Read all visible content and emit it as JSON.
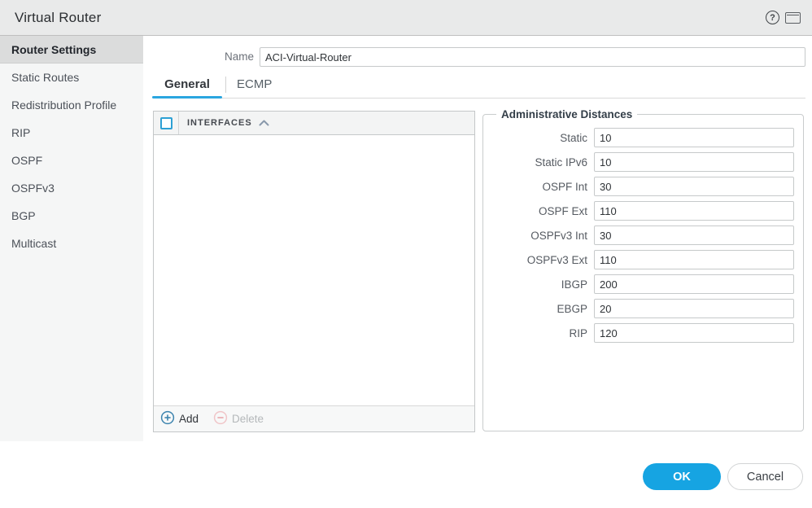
{
  "dialog": {
    "title": "Virtual Router"
  },
  "titlebar": {
    "help_icon": "?",
    "icons": [
      "help-icon",
      "window-icon"
    ]
  },
  "sidebar": {
    "items": [
      {
        "label": "Router Settings",
        "selected": true
      },
      {
        "label": "Static Routes",
        "selected": false
      },
      {
        "label": "Redistribution Profile",
        "selected": false
      },
      {
        "label": "RIP",
        "selected": false
      },
      {
        "label": "OSPF",
        "selected": false
      },
      {
        "label": "OSPFv3",
        "selected": false
      },
      {
        "label": "BGP",
        "selected": false
      },
      {
        "label": "Multicast",
        "selected": false
      }
    ]
  },
  "form": {
    "name_label": "Name",
    "name_value": "ACI-Virtual-Router"
  },
  "tabs": [
    {
      "label": "General",
      "active": true
    },
    {
      "label": "ECMP",
      "active": false
    }
  ],
  "interfaces_table": {
    "column_header": "INTERFACES",
    "sort_direction": "ascending",
    "rows": [],
    "add_label": "Add",
    "delete_label": "Delete",
    "delete_enabled": false
  },
  "admin_distances": {
    "legend": "Administrative Distances",
    "fields": [
      {
        "label": "Static",
        "value": "10"
      },
      {
        "label": "Static IPv6",
        "value": "10"
      },
      {
        "label": "OSPF Int",
        "value": "30"
      },
      {
        "label": "OSPF Ext",
        "value": "110"
      },
      {
        "label": "OSPFv3 Int",
        "value": "30"
      },
      {
        "label": "OSPFv3 Ext",
        "value": "110"
      },
      {
        "label": "IBGP",
        "value": "200"
      },
      {
        "label": "EBGP",
        "value": "20"
      },
      {
        "label": "RIP",
        "value": "120"
      }
    ]
  },
  "footer": {
    "ok_label": "OK",
    "cancel_label": "Cancel"
  },
  "colors": {
    "accent_blue": "#16a4e2",
    "tab_underline": "#2aa6e0",
    "checkbox_border": "#2da0d4",
    "add_icon_blue": "#3d84ae",
    "delete_icon_pink": "#e9a6ab",
    "titlebar_bg": "#e9eaea",
    "sidebar_bg": "#f5f6f6",
    "sidebar_selected_bg": "#dbdcdc"
  }
}
